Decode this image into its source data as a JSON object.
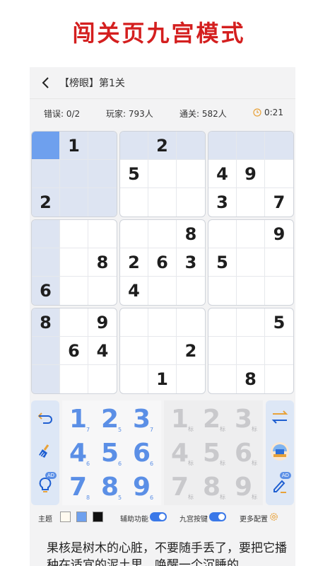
{
  "headline": "闯关页九宫模式",
  "nav": {
    "title": "【榜眼】第1关"
  },
  "stats": {
    "errors": "错误: 0/2",
    "players": "玩家: 793人",
    "passed": "通关: 582人",
    "time": "0:21"
  },
  "board": {
    "rows": [
      [
        "",
        "1",
        "",
        "",
        "2",
        "",
        "",
        "",
        ""
      ],
      [
        "",
        "",
        "",
        "5",
        "",
        "",
        "4",
        "9",
        ""
      ],
      [
        "2",
        "",
        "",
        "",
        "",
        "",
        "3",
        "",
        "7"
      ],
      [
        "",
        "",
        "",
        "",
        "",
        "8",
        "",
        "",
        "9"
      ],
      [
        "",
        "",
        "8",
        "2",
        "6",
        "3",
        "5",
        "",
        ""
      ],
      [
        "6",
        "",
        "",
        "4",
        "",
        "",
        "",
        "",
        ""
      ],
      [
        "8",
        "",
        "9",
        "",
        "",
        "",
        "",
        "",
        "5"
      ],
      [
        "",
        "6",
        "4",
        "",
        "",
        "2",
        "",
        "",
        ""
      ],
      [
        "",
        "",
        "",
        "",
        "1",
        "",
        "",
        "8",
        ""
      ]
    ],
    "selected_cell": [
      0,
      0
    ],
    "highlight_color": "#dde4f2",
    "selected_color": "#6ea0ee"
  },
  "keypad": {
    "digits": [
      {
        "digit": "1",
        "count": "7"
      },
      {
        "digit": "2",
        "count": "5"
      },
      {
        "digit": "3",
        "count": "7"
      },
      {
        "digit": "4",
        "count": "6"
      },
      {
        "digit": "5",
        "count": "6"
      },
      {
        "digit": "6",
        "count": "6"
      },
      {
        "digit": "7",
        "count": "8"
      },
      {
        "digit": "8",
        "count": "5"
      },
      {
        "digit": "9",
        "count": "6"
      }
    ],
    "note_digits": [
      {
        "digit": "1",
        "tag": "标"
      },
      {
        "digit": "2",
        "tag": "标"
      },
      {
        "digit": "3",
        "tag": "标"
      },
      {
        "digit": "4",
        "tag": "标"
      },
      {
        "digit": "5",
        "tag": "标"
      },
      {
        "digit": "6",
        "tag": "标"
      },
      {
        "digit": "7",
        "tag": "标"
      },
      {
        "digit": "8",
        "tag": "标"
      },
      {
        "digit": "9",
        "tag": "标"
      }
    ],
    "accent_color": "#5b8fe6",
    "ad_label": "AD"
  },
  "settings": {
    "theme_label": "主题",
    "theme_colors": [
      "#fffaf0",
      "#6ea0ee",
      "#111111"
    ],
    "assist_label": "辅助功能",
    "grid_keys_label": "九宫按键",
    "more_label": "更多配置"
  },
  "tip": "果核是树木的心脏，不要随手丢了，要把它播种在适宜的泥土里，唤醒一个沉睡的"
}
